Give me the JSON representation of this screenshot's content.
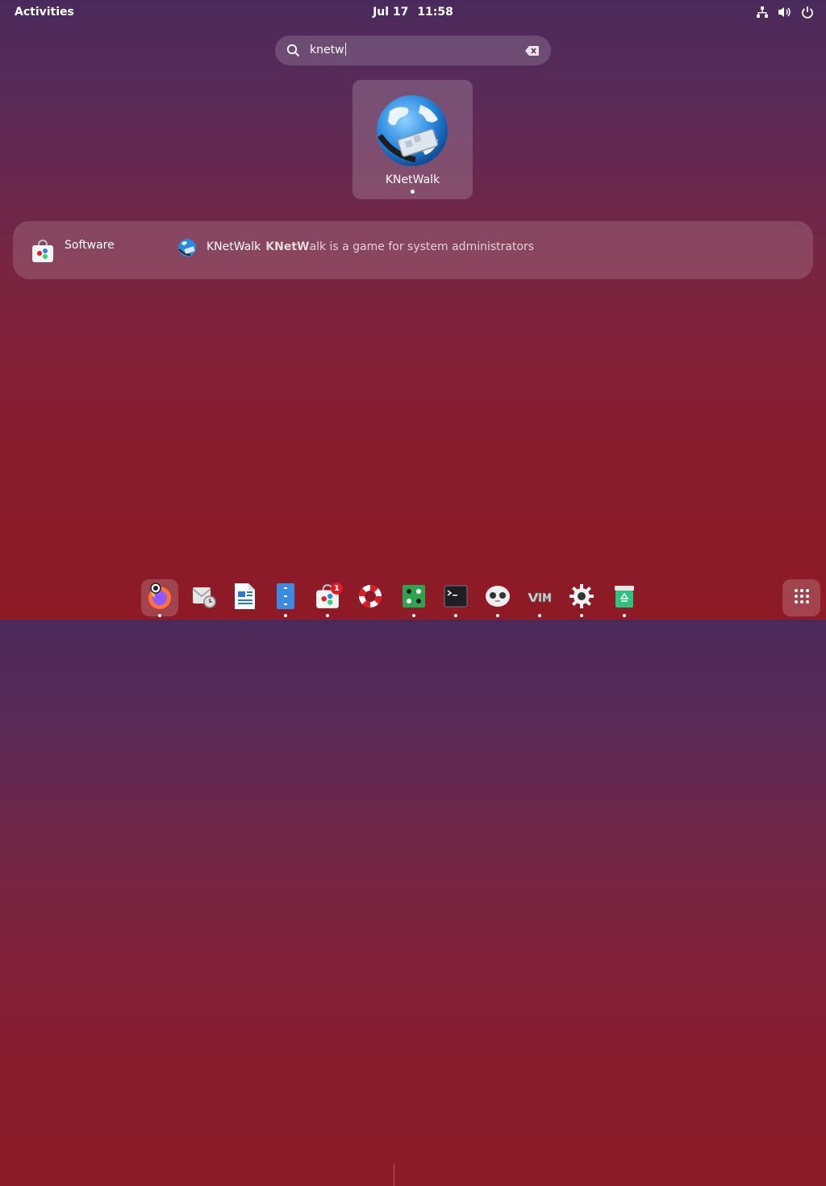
{
  "topbar": {
    "activities": "Activities",
    "date": "Jul 17",
    "time": "11:58",
    "tray_icons": [
      "network-icon",
      "volume-icon",
      "power-icon"
    ]
  },
  "search": {
    "value": "knetw",
    "icon": "search-icon",
    "clear_icon": "clear-icon"
  },
  "app_result": {
    "label": "KNetWalk",
    "icon": "knetwalk-icon"
  },
  "provider": {
    "name": "Software",
    "icon": "software-store-icon",
    "result": {
      "title": "KNetWalk",
      "desc_highlight": "KNetW",
      "desc_rest": "alk is a game for system administrators",
      "icon": "knetwalk-small-icon"
    }
  },
  "dock": {
    "items": [
      {
        "name": "firefox",
        "running": true,
        "active": true
      },
      {
        "name": "evolution",
        "running": false
      },
      {
        "name": "libreoffice-writer",
        "running": false
      },
      {
        "name": "files",
        "running": true
      },
      {
        "name": "software",
        "running": true,
        "badge": "1"
      },
      {
        "name": "help",
        "running": false
      },
      {
        "name": "knetwalk-game",
        "running": true
      },
      {
        "name": "terminal",
        "running": true
      },
      {
        "name": "robot-app",
        "running": true
      },
      {
        "name": "vim",
        "running": true
      },
      {
        "name": "settings",
        "running": true
      },
      {
        "name": "trash",
        "running": true
      }
    ],
    "apps_grid_icon": "show-apps-icon"
  },
  "colors": {
    "bg_top": "#4a2a5c",
    "bg_bottom": "#8e1a26",
    "badge": "#e01b24"
  }
}
